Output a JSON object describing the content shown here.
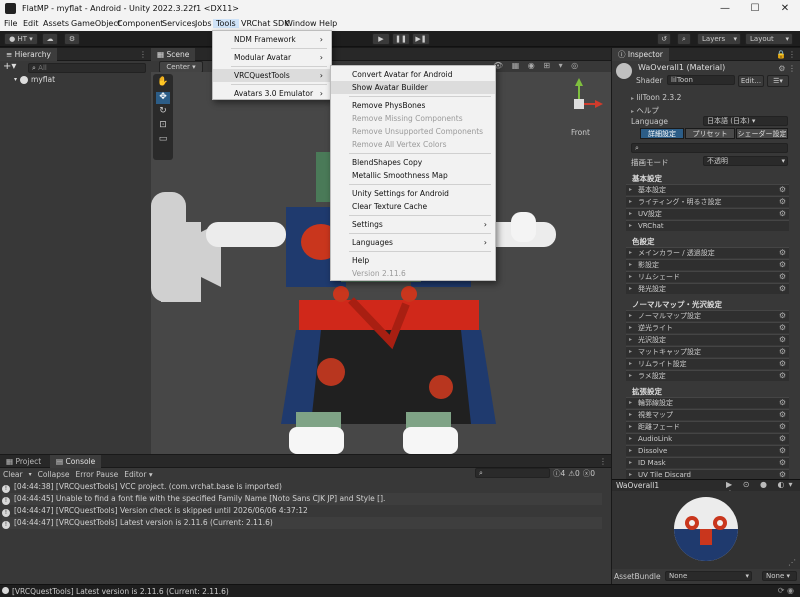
{
  "window": {
    "title": "FlatMP - myflat - Android - Unity 2022.3.22f1 <DX11>",
    "minimize": "—",
    "maximize": "☐",
    "close": "✕"
  },
  "menubar": [
    "File",
    "Edit",
    "Assets",
    "GameObject",
    "Component",
    "Services",
    "Jobs",
    "Tools",
    "VRChat SDK",
    "Window",
    "Help"
  ],
  "toolbar": {
    "account": "HT",
    "play": "▶",
    "pause": "❚❚",
    "step": "▶❚",
    "layers": "Layers",
    "layout": "Layout"
  },
  "tools_menu": {
    "items": [
      {
        "label": "NDM Framework",
        "submenu": true
      },
      {
        "label": "Modular Avatar",
        "submenu": true
      },
      {
        "label": "VRCQuestTools",
        "submenu": true
      },
      {
        "label": "Avatars 3.0 Emulator",
        "submenu": true
      }
    ]
  },
  "vrcquest_menu": {
    "items": [
      {
        "label": "Convert Avatar for Android",
        "state": "normal"
      },
      {
        "label": "Show Avatar Builder",
        "state": "highlight"
      },
      {
        "label": "Remove PhysBones",
        "state": "normal"
      },
      {
        "label": "Remove Missing Components",
        "state": "disabled"
      },
      {
        "label": "Remove Unsupported Components",
        "state": "disabled"
      },
      {
        "label": "Remove All Vertex Colors",
        "state": "disabled"
      },
      {
        "label": "BlendShapes Copy",
        "state": "normal"
      },
      {
        "label": "Metallic Smoothness Map",
        "state": "normal"
      },
      {
        "label": "Unity Settings for Android",
        "state": "normal"
      },
      {
        "label": "Clear Texture Cache",
        "state": "normal"
      },
      {
        "label": "Settings",
        "state": "normal",
        "submenu": true
      },
      {
        "label": "Languages",
        "state": "normal",
        "submenu": true
      },
      {
        "label": "Help",
        "state": "normal"
      },
      {
        "label": "Version 2.11.6",
        "state": "disabled"
      }
    ]
  },
  "hierarchy": {
    "tab": "Hierarchy",
    "search_placeholder": "All",
    "root": "myflat"
  },
  "scene": {
    "tab": "Scene",
    "pivot": "Center",
    "gizmo_label": "Front"
  },
  "inspector": {
    "tab": "Inspector",
    "material_name": "WaOverall1 (Material)",
    "shader_label": "Shader",
    "shader_value": "lilToon",
    "edit_button": "Edit...",
    "version": "lilToon 2.3.2",
    "help": "ヘルプ",
    "language_label": "Language",
    "language_value": "日本語 (日本)",
    "mode_buttons": [
      "詳細設定",
      "プリセット",
      "シェーダー設定"
    ],
    "render_mode_label": "描画モード",
    "render_mode_value": "不透明",
    "sections": [
      {
        "header": "基本設定",
        "rows": [
          "基本設定",
          "ライティング・明るさ設定",
          "UV設定",
          "VRChat"
        ]
      },
      {
        "header": "色設定",
        "rows": [
          "メインカラー / 透過設定",
          "影設定",
          "リムシェード",
          "発光設定"
        ]
      },
      {
        "header": "ノーマルマップ・光沢設定",
        "rows": [
          "ノーマルマップ設定",
          "逆光ライト",
          "光沢設定",
          "マットキャップ設定",
          "リムライト設定",
          "ラメ設定"
        ]
      },
      {
        "header": "拡張設定",
        "rows": [
          "輪郭線設定",
          "視差マップ",
          "距離フェード",
          "AudioLink",
          "Dissolve",
          "ID Mask",
          "UV Tile Discard"
        ]
      }
    ],
    "preview_name": "WaOverall1",
    "assetbundle_label": "AssetBundle",
    "assetbundle_value": "None",
    "assetbundle_variant": "None"
  },
  "console": {
    "tabs": [
      "Project",
      "Console"
    ],
    "toolbar": [
      "Clear",
      "Collapse",
      "Error Pause",
      "Editor"
    ],
    "counts": [
      "4",
      "0",
      "0"
    ],
    "logs": [
      "[04:44:38] [VRCQuestTools] VCC project. (com.vrchat.base is imported)",
      "[04:44:45] Unable to find a font file with the specified Family Name [Noto Sans CJK JP] and Style [].",
      "[04:44:47] [VRCQuestTools] Version check is skipped until 2026/06/06 4:37:12",
      "[04:44:47] [VRCQuestTools] Latest version is 2.11.6 (Current: 2.11.6)"
    ]
  },
  "statusbar": "[VRCQuestTools] Latest version is 2.11.6 (Current: 2.11.6)",
  "colors": {
    "accent": "#2c5d87",
    "menu_bg": "#f2f2f2",
    "editor_bg": "#383838",
    "scene_bg": "#474747",
    "kimono_blue": "#1f3a6e",
    "sash_red": "#d0281a",
    "skin_green": "#7fa386"
  }
}
